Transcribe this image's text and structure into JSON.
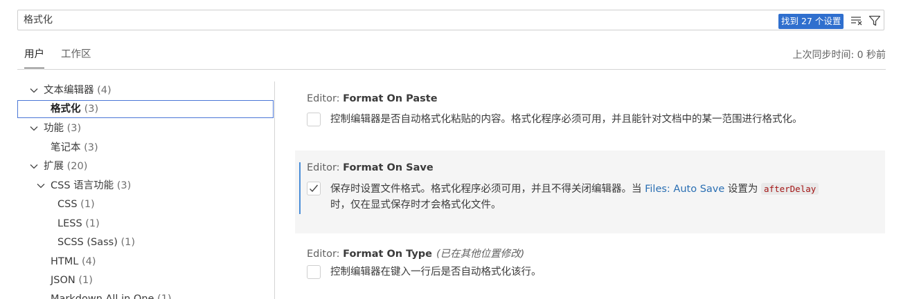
{
  "search": {
    "value": "格式化",
    "result_count": "找到 27 个设置"
  },
  "tabs": [
    {
      "label": "用户"
    },
    {
      "label": "工作区"
    }
  ],
  "sync_status": "上次同步时间: 0 秒前",
  "tree": [
    {
      "label": "文本编辑器",
      "count": "(4)"
    },
    {
      "label": "格式化",
      "count": "(3)"
    },
    {
      "label": "功能",
      "count": "(3)"
    },
    {
      "label": "笔记本",
      "count": "(3)"
    },
    {
      "label": "扩展",
      "count": "(20)"
    },
    {
      "label": "CSS 语言功能",
      "count": "(3)"
    },
    {
      "label": "CSS",
      "count": "(1)"
    },
    {
      "label": "LESS",
      "count": "(1)"
    },
    {
      "label": "SCSS (Sass)",
      "count": "(1)"
    },
    {
      "label": "HTML",
      "count": "(4)"
    },
    {
      "label": "JSON",
      "count": "(1)"
    },
    {
      "label": "Markdown All in One",
      "count": "(1)"
    }
  ],
  "settings": [
    {
      "category": "Editor: ",
      "name": "Format On Paste",
      "checked": false,
      "description": "控制编辑器是否自动格式化粘贴的内容。格式化程序必须可用，并且能针对文档中的某一范围进行格式化。"
    },
    {
      "category": "Editor: ",
      "name": "Format On Save",
      "checked": true,
      "desc_part1": "保存时设置文件格式。格式化程序必须可用，并且不得关闭编辑器。当 ",
      "desc_link": "Files: Auto Save",
      "desc_part2": " 设置为 ",
      "desc_code": "afterDelay",
      "desc_part3": "时，仅在显式保存时才会格式化文件。"
    },
    {
      "category": "Editor: ",
      "name": "Format On Type",
      "modified_note": "(已在其他位置修改)",
      "checked": false,
      "description": "控制编辑器在键入一行后是否自动格式化该行。"
    }
  ],
  "colors": {
    "accent": "#2f6fce",
    "link": "#2a6fb3",
    "focus_bar": "#4a8ed8",
    "selected_border": "#4a76d6"
  }
}
